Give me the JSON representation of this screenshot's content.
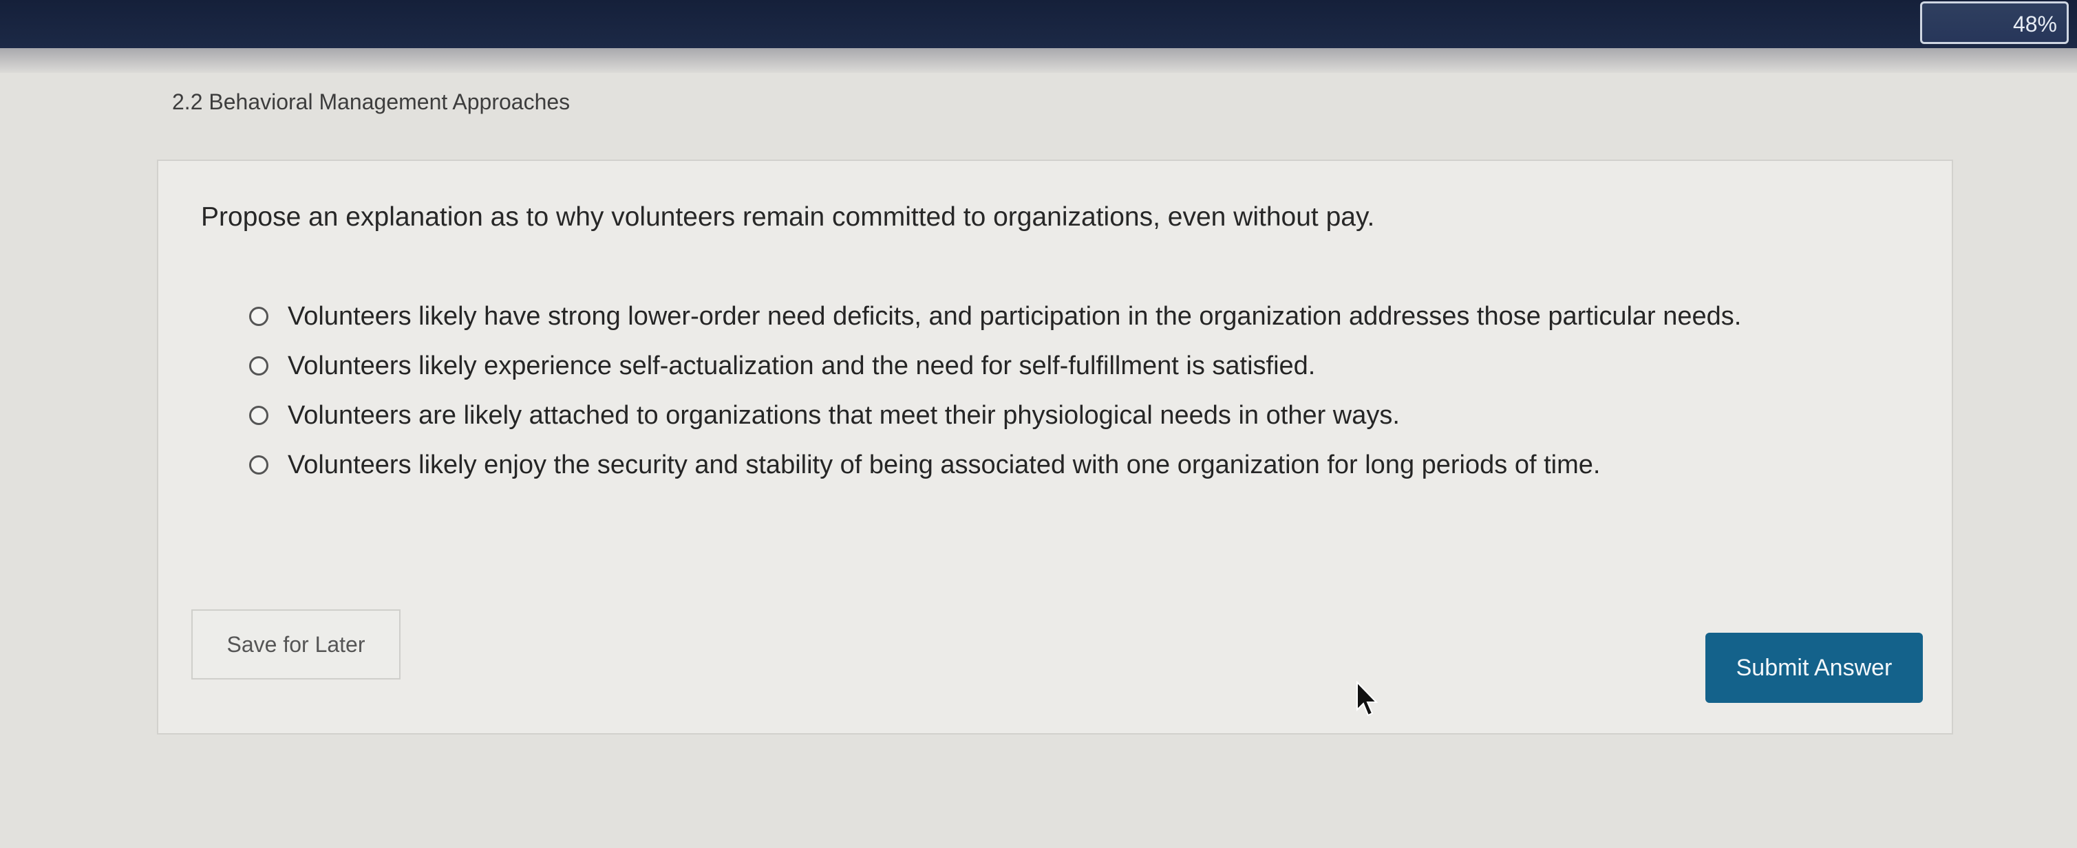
{
  "header": {
    "progress": "48%"
  },
  "section": {
    "title": "2.2 Behavioral Management Approaches"
  },
  "question": {
    "prompt": "Propose an explanation as to why volunteers remain committed to organizations, even without pay.",
    "options": [
      "Volunteers likely have strong lower-order need deficits, and participation in the organization addresses those particular needs.",
      "Volunteers likely experience self-actualization and the need for self-fulfillment is satisfied.",
      "Volunteers are likely attached to organizations that meet their physiological needs in other ways.",
      "Volunteers likely enjoy the security and stability of being associated with one organization for long periods of time."
    ]
  },
  "actions": {
    "save_label": "Save for Later",
    "submit_label": "Submit Answer"
  }
}
